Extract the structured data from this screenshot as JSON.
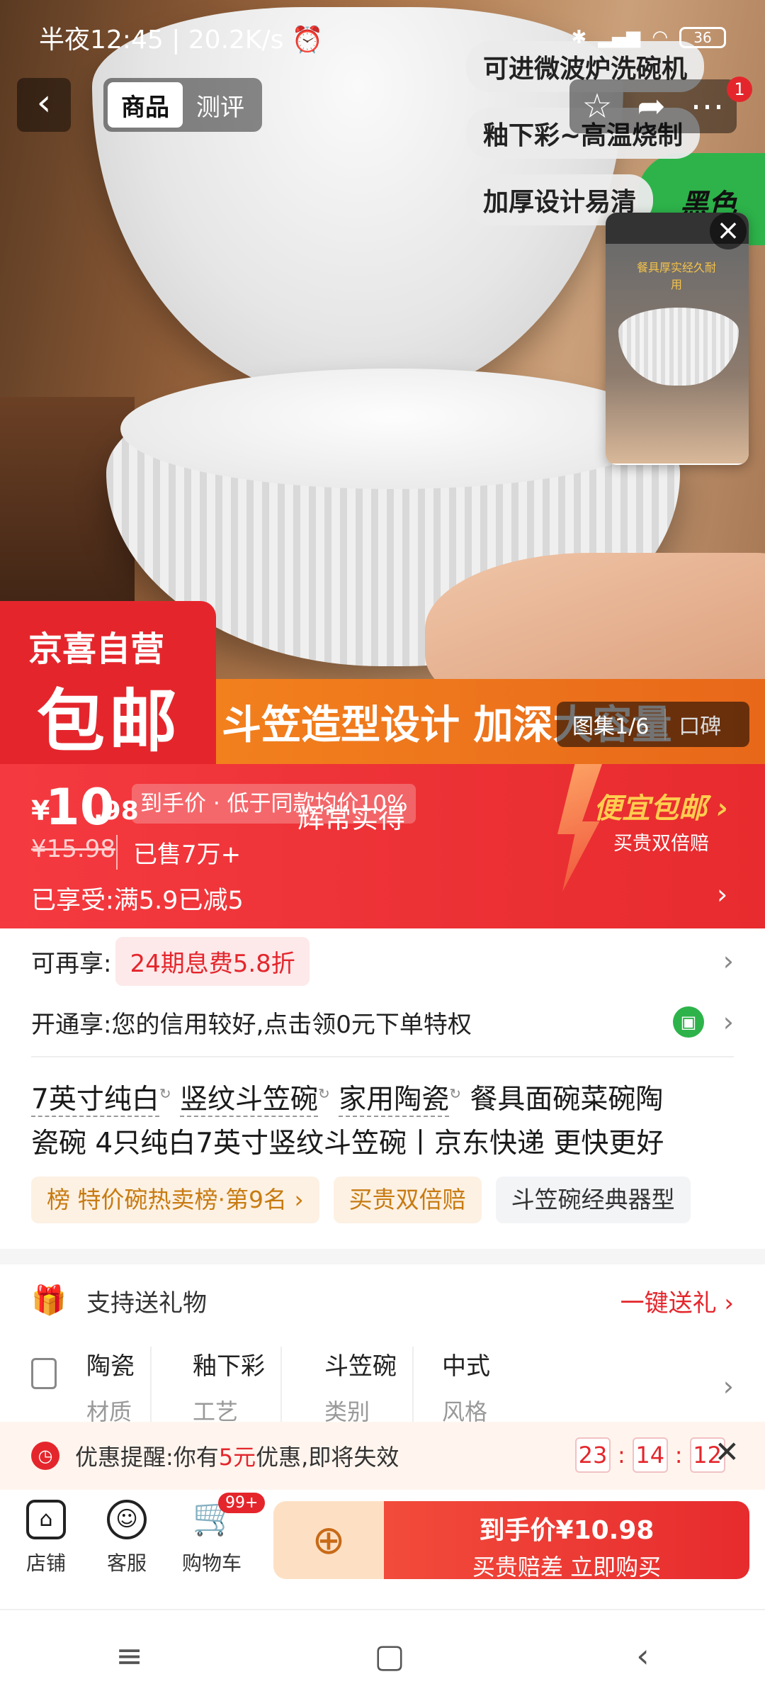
{
  "status": {
    "time": "半夜12:45",
    "speed": "20.2K/s",
    "alarm_icon": "alarm-icon",
    "battery": "36"
  },
  "nav": {
    "tabs": [
      {
        "label": "商品",
        "active": true
      },
      {
        "label": "测评",
        "active": false
      }
    ],
    "badge": "1"
  },
  "hero": {
    "tags": [
      "可进微波炉洗碗机",
      "釉下彩~高温烧制",
      "加厚设计易清"
    ],
    "green_tab": "黑色",
    "pip_text": "餐具厚实经久耐用",
    "jx_line1": "京喜自营",
    "jx_line2": "包邮",
    "banner": "斗笠造型设计 加深大容量",
    "gallery": "图集1/6",
    "gallery_more": "口碑"
  },
  "price": {
    "currency": "¥",
    "int": "10",
    "dec": ".98",
    "chip": "到手价 · 低于同款均价10%",
    "subtitle": "辉常实得",
    "old": "¥15.98",
    "sold": "已售7万+",
    "promo": "已享受:满5.9已减5",
    "cheap_title": "便宜包邮 ›",
    "cheap_sub": "买贵双倍赔"
  },
  "rows": {
    "again_label": "可再享:",
    "again_chip": "24期息费5.8折",
    "open_label": "开通享:您的信用较好,点击领0元下单特权"
  },
  "title": {
    "k1": "7英寸纯白",
    "k2": "竖纹斗笠碗",
    "k3": "家用陶瓷",
    "rest1": "餐具面碗菜碗陶",
    "rest2": "瓷碗 4只纯白7英寸竖纹斗笠碗丨京东快递 更快更好"
  },
  "badges": [
    "榜 特价碗热卖榜·第9名 ›",
    "买贵双倍赔",
    "斗笠碗经典器型"
  ],
  "gift": {
    "label": "支持送礼物",
    "link": "一键送礼 ›"
  },
  "attrs": [
    {
      "v": "陶瓷",
      "k": "材质"
    },
    {
      "v": "釉下彩",
      "k": "工艺"
    },
    {
      "v": "斗笠碗",
      "k": "类别"
    },
    {
      "v": "中式",
      "k": "风格"
    }
  ],
  "reminder": {
    "pre": "优惠提醒:你有",
    "amount": "5元",
    "post": "优惠,即将失效",
    "h": "23",
    "m": "14",
    "s": "12"
  },
  "bottom": {
    "shop": "店铺",
    "service": "客服",
    "cart": "购物车",
    "cart_badge": "99+",
    "buy_l1": "到手价¥10.98",
    "buy_l2": "买贵赔差 立即购买"
  },
  "colors": {
    "accent": "#e4262c",
    "orange": "#f2801d",
    "green": "#2db34a"
  }
}
